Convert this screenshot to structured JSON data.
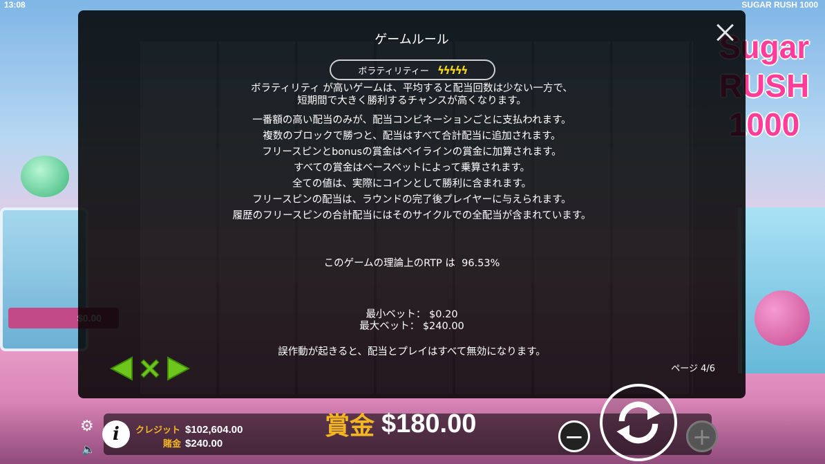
{
  "status": {
    "time": "13:08",
    "game_name": "SUGAR RUSH 1000"
  },
  "background": {
    "logo_lines": [
      "Sugar",
      "RUSH",
      "1000"
    ],
    "left_bar_value": "$0.00"
  },
  "modal": {
    "title": "ゲームルール",
    "volatility_label": "ボラティリティー",
    "volatility_level": 5,
    "volatility_icon": "lightning-bolt-icon",
    "rules": {
      "line1a": "ボラティリティ が高いゲームは、平均すると配当回数は少ない一方で、",
      "line1b": "短期間で大きく勝利するチャンスが高くなります。",
      "line2": "一番額の高い配当のみが、配当コンビネーションごとに支払われます。",
      "line3": "複数のブロックで勝つと、配当はすべて合計配当に追加されます。",
      "line4": "フリースピンとbonusの賞金はペイラインの賞金に加算されます。",
      "line5": "すべての賞金はベースベットによって乗算されます。",
      "line6": "全ての値は、実際にコインとして勝利に含まれます。",
      "line7": "フリースピンの配当は、ラウンドの完了後プレイヤーに与えられます。",
      "line8": "履歴のフリースピンの合計配当にはそのサイクルでの全配当が含まれています。"
    },
    "rtp_label": "このゲームの理論上のRTP は",
    "rtp_value": "96.53%",
    "min_bet_label": "最小ベット：",
    "min_bet_value": "$0.20",
    "max_bet_label": "最大ベット：",
    "max_bet_value": "$240.00",
    "malfunction": "誤作動が起きると、配当とプレイはすべて無効になります。",
    "page_indicator": "ページ 4/6",
    "nav_color": "#6ec51c"
  },
  "bottom": {
    "credit_label": "クレジット",
    "credit_value": "$102,604.00",
    "bet_label": "賭金",
    "bet_value": "$240.00",
    "win_label": "賞金",
    "win_value": "$180.00",
    "minus": "−",
    "plus": "+"
  }
}
